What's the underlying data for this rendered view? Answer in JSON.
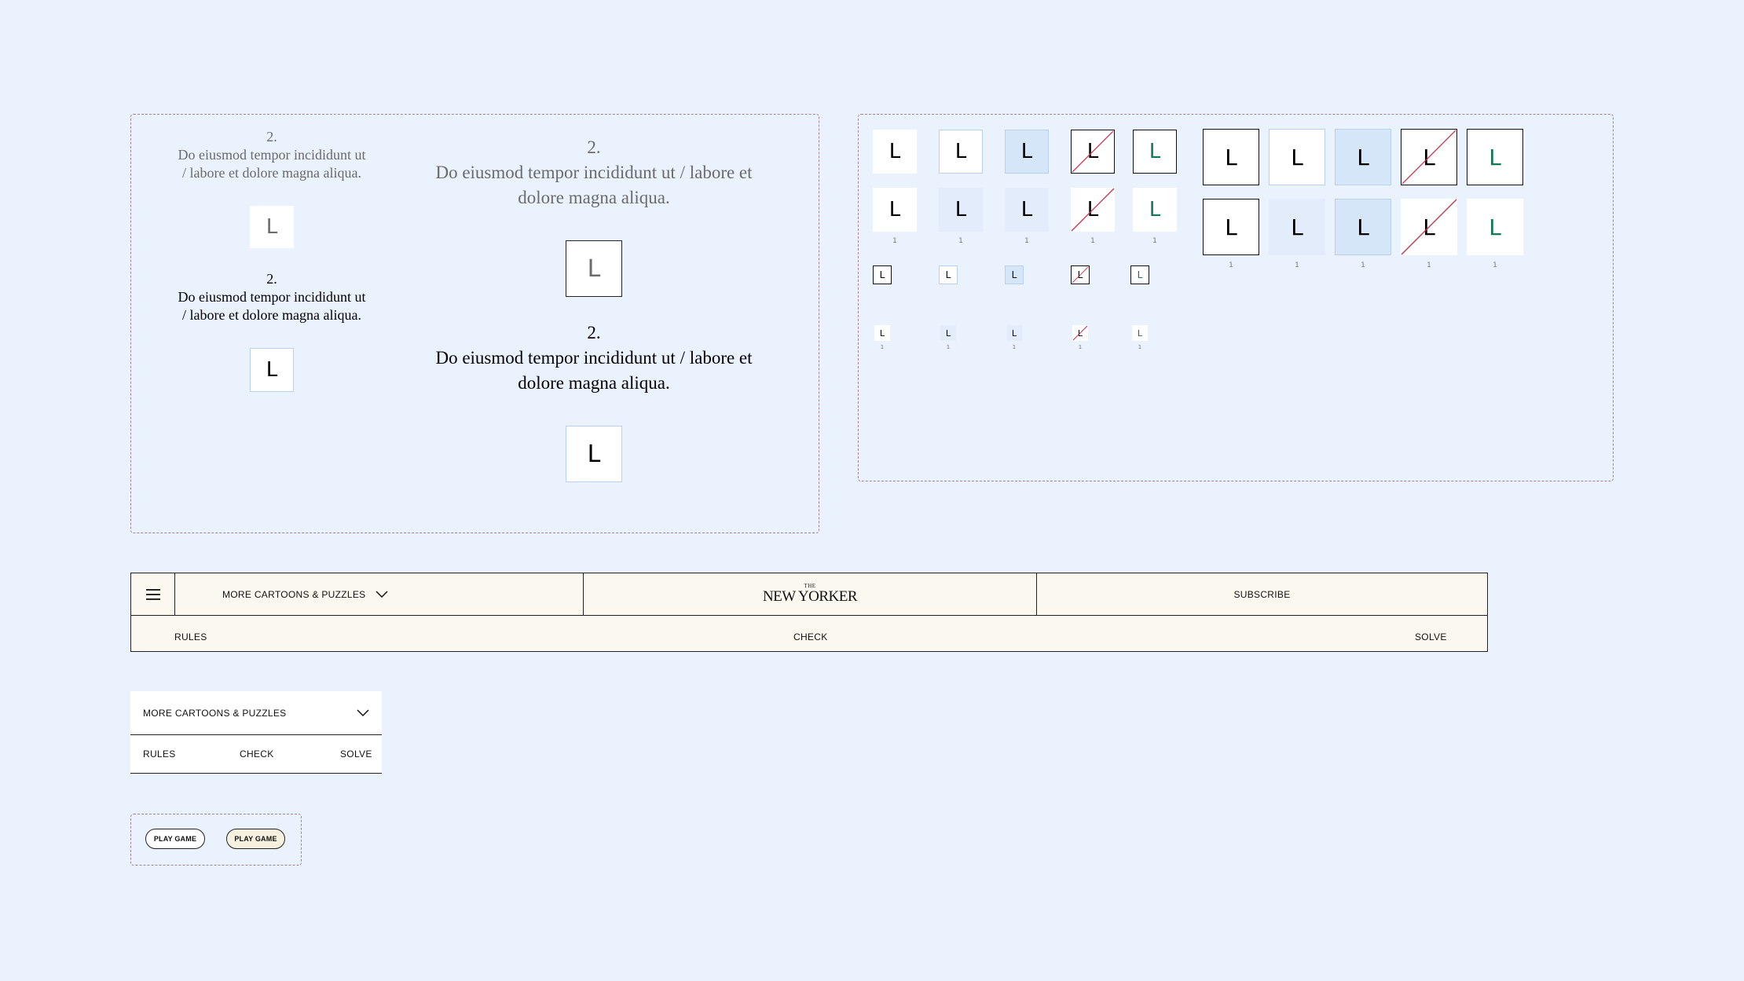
{
  "clue_panel": {
    "number": "2.",
    "text": "Do eiusmod tempor incididunt ut / labore et dolore magna aliqua.",
    "text_small_line1": "Do eiusmod tempor incididunt ut",
    "text_small_line2": "/ labore et dolore magna aliqua.",
    "text_large_line1": "Do eiusmod tempor incididunt ut / labore et",
    "text_large_line2": "dolore magna aliqua.",
    "letter": "L"
  },
  "tiles": {
    "letter": "L",
    "index": "1"
  },
  "nav": {
    "menu_icon": "hamburger-icon",
    "more_label": "MORE CARTOONS & PUZZLES",
    "chevron_icon": "chevron-down-icon",
    "logo_top": "THE",
    "logo_main": "NEW YORKER",
    "subscribe_label": "SUBSCRIBE",
    "rules_label": "RULES",
    "check_label": "CHECK",
    "solve_label": "SOLVE"
  },
  "mobile_nav": {
    "more_label": "MORE CARTOONS & PUZZLES",
    "rules_label": "RULES",
    "check_label": "CHECK",
    "solve_label": "SOLVE"
  },
  "buttons": {
    "play_game_1": "PLAY GAME",
    "play_game_2": "PLAY GAME"
  },
  "colors": {
    "background": "#eaf2fd",
    "frame_dash": "#a77fa8",
    "nav_bg": "#faf8ef",
    "correct_green": "#127a52",
    "wrong_strike": "#c0324a",
    "highlight": "#e2ecfa"
  }
}
